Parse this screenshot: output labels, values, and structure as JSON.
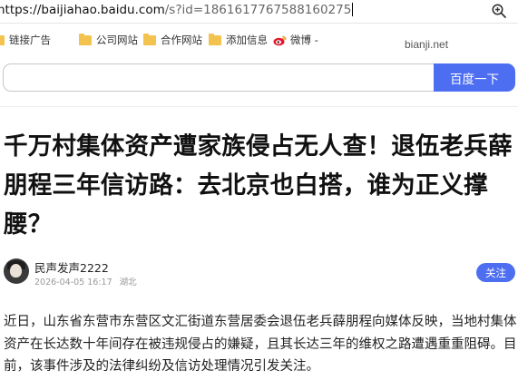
{
  "address_bar": {
    "host": "https://baijiahao.baidu.com",
    "path": "/s?id=1861617767588160275"
  },
  "icons": {
    "zoom": "magnifier-zoom-icon",
    "folder": "bookmark-folder-icon",
    "weibo": "weibo-logo-icon"
  },
  "bookmarks": [
    {
      "label": "链接广告"
    },
    {
      "label": "公司网站"
    },
    {
      "label": "合作网站"
    },
    {
      "label": "添加信息"
    },
    {
      "label": "微博 -"
    }
  ],
  "watermark": "bianji.net",
  "search": {
    "value": "",
    "button_label": "百度一下"
  },
  "article": {
    "title": "千万村集体资产遭家族侵占无人查！退伍老兵薛朋程三年信访路：去北京也白搭，谁为正义撑腰？",
    "author": "民声发声2222",
    "date": "2026-04-05 16:17",
    "location": "湖北",
    "follow_label": "关注",
    "body": "近日，山东省东营市东营区文汇街道东营居委会退伍老兵薛朋程向媒体反映，当地村集体资产在长达数十年间存在被违规侵占的嫌疑，且其长达三年的维权之路遭遇重重阻碍。目前，该事件涉及的法律纠纷及信访处理情况引发关注。"
  },
  "colors": {
    "accent": "#4e6ef2",
    "folder": "#f3c24f",
    "weibo": "#e6162d"
  }
}
